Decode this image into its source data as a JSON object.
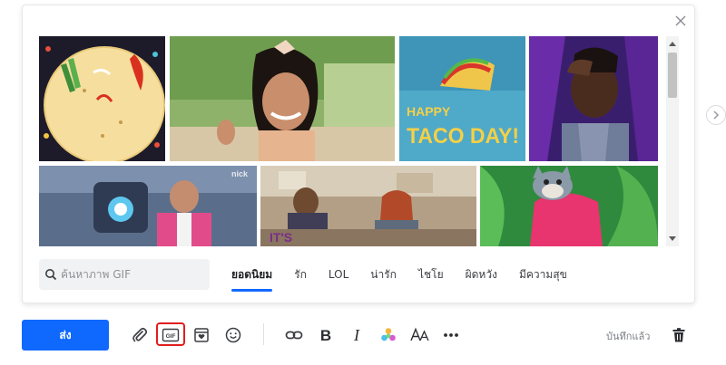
{
  "picker": {
    "search_placeholder": "ค้นหาภาพ GIF",
    "tabs": [
      {
        "label": "ยอดนิยม",
        "active": true
      },
      {
        "label": "รัก",
        "active": false
      },
      {
        "label": "LOL",
        "active": false
      },
      {
        "label": "น่ารัก",
        "active": false
      },
      {
        "label": "ไชโย",
        "active": false
      },
      {
        "label": "ผิดหวัง",
        "active": false
      },
      {
        "label": "มีความสุข",
        "active": false
      }
    ],
    "gif_texts": {
      "taco_line1": "HAPPY",
      "taco_line2": "TACO DAY!",
      "nick_watermark": "nick",
      "caption_fragment": "IT'S"
    }
  },
  "toolbar": {
    "send_label": "ส่ง",
    "gif_label": "GIF",
    "saved_status": "บันทึกแล้ว"
  },
  "colors": {
    "accent": "#0f69ff",
    "highlight": "#e01e1e"
  },
  "icons": [
    "close-icon",
    "search-icon",
    "chevron-right-icon",
    "paperclip-icon",
    "gif-icon",
    "sticker-icon",
    "emoji-icon",
    "link-icon",
    "bold-icon",
    "italic-icon",
    "color-palette-icon",
    "font-size-icon",
    "more-icon",
    "trash-icon"
  ]
}
